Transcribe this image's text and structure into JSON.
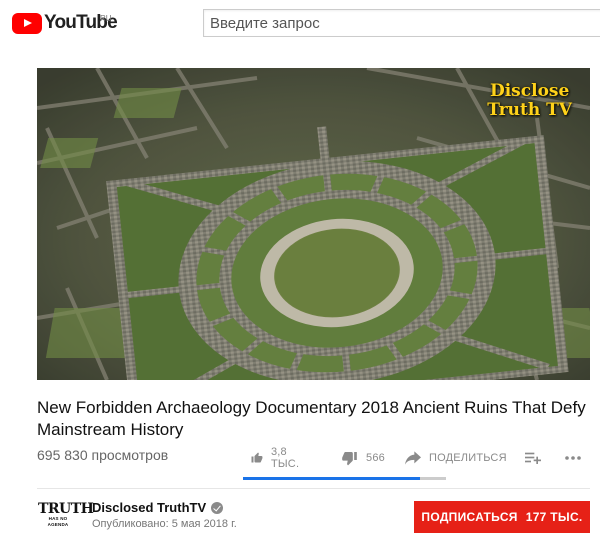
{
  "header": {
    "logo_text": "YouTube",
    "logo_country": "RU",
    "search_placeholder": "Введите запрос"
  },
  "player": {
    "watermark_line1": "Disclose",
    "watermark_line2": "Truth TV"
  },
  "video": {
    "title": "New Forbidden Archaeology Documentary 2018 Ancient Ruins That Defy Mainstream History",
    "views": "695 830 просмотров",
    "likes": "3,8 ТЫС.",
    "dislikes": "566",
    "share_label": "ПОДЕЛИТЬСЯ",
    "like_ratio": 0.87
  },
  "channel": {
    "avatar_line1": "TRUTH",
    "avatar_line2": "HAS NO AGENDA",
    "name": "Disclosed TruthTV",
    "published": "Опубликовано: 5 мая 2018 г.",
    "subscribe_label": "ПОДПИСАТЬСЯ",
    "subscriber_count": "177 ТЫС."
  },
  "icons": {
    "like": "thumbs-up-icon",
    "dislike": "thumbs-down-icon",
    "share": "share-icon",
    "add_to_playlist": "playlist-add-icon",
    "more": "more-horizontal-icon",
    "verified": "verified-check-icon"
  },
  "colors": {
    "brand_red": "#ff0000",
    "subscribe_red": "#e62117",
    "like_bar": "#1a73e8",
    "watermark": "#ffd21a"
  }
}
